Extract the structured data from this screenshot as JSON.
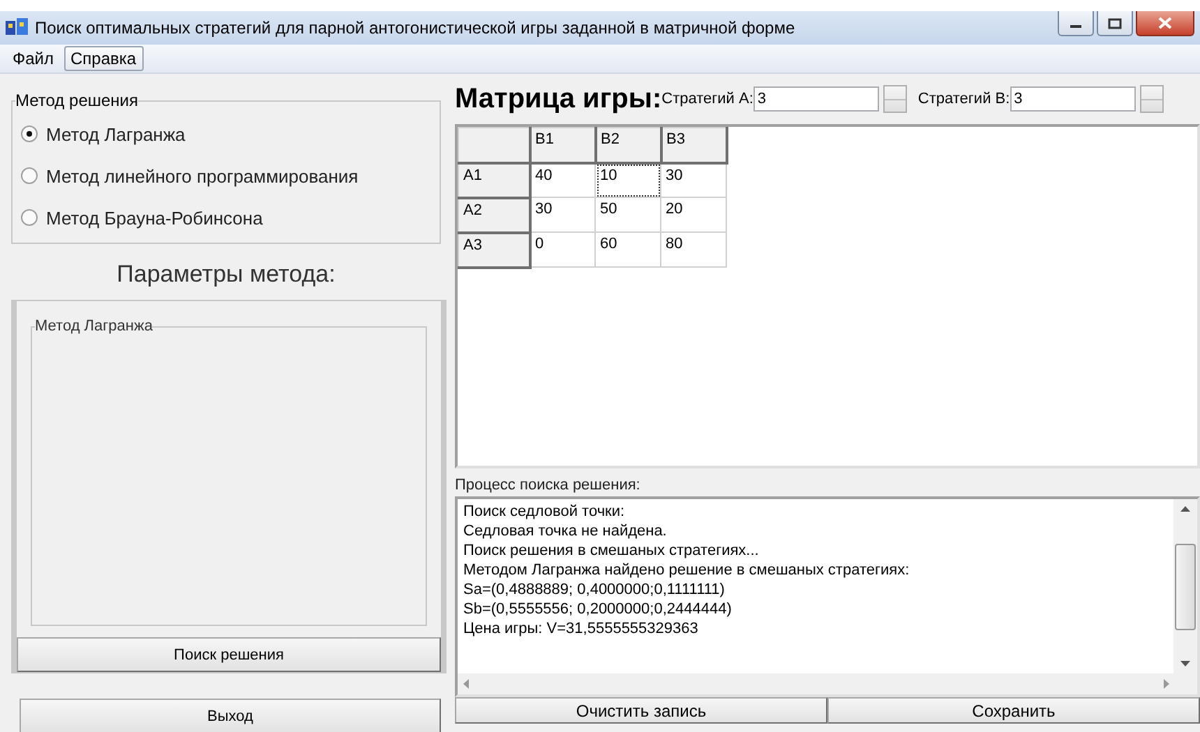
{
  "window": {
    "title": "Поиск оптимальных стратегий для парной антогонистической игры заданной в матричной форме"
  },
  "menu": [
    {
      "label": "Файл",
      "selected": false
    },
    {
      "label": "Справка",
      "selected": true
    }
  ],
  "method_group": {
    "title": "Метод решения",
    "options": [
      {
        "label": "Метод Лагранжа",
        "selected": true
      },
      {
        "label": "Метод линейного программирования",
        "selected": false
      },
      {
        "label": "Метод Брауна-Робинсона",
        "selected": false
      }
    ]
  },
  "params_title": "Параметры метода:",
  "params_group": {
    "title": "Метод Лагранжа"
  },
  "search_button": "Поиск решения",
  "exit_button": "Выход",
  "matrix": {
    "title": "Матрица игры:",
    "strategies": [
      {
        "label": "Стратегий А:",
        "value": "3"
      },
      {
        "label": "Стратегий В:",
        "value": "3"
      }
    ],
    "columns": [
      "B1",
      "B2",
      "B3"
    ],
    "rows": [
      {
        "header": "A1",
        "cells": [
          {
            "value": "40",
            "focused": false
          },
          {
            "value": "10",
            "focused": true
          },
          {
            "value": "30",
            "focused": false
          }
        ]
      },
      {
        "header": "A2",
        "cells": [
          {
            "value": "30",
            "focused": false
          },
          {
            "value": "50",
            "focused": false
          },
          {
            "value": "20",
            "focused": false
          }
        ]
      },
      {
        "header": "A3",
        "cells": [
          {
            "value": "0",
            "focused": false
          },
          {
            "value": "60",
            "focused": false
          },
          {
            "value": "80",
            "focused": false
          }
        ]
      }
    ]
  },
  "log": {
    "title": "Процесс поиска решения:",
    "lines": [
      "Поиск седловой точки:",
      "Седловая точка не найдена.",
      "Поиск решения в смешаных стратегиях...",
      "Методом Лагранжа найдено решение в смешаных стратегиях:",
      "Sa=(0,4888889; 0,4000000;0,1111111)",
      "Sb=(0,5555556; 0,2000000;0,2444444)",
      "Цена игры: V=31,5555555329363"
    ]
  },
  "log_buttons": [
    "Очистить запись",
    "Сохранить"
  ]
}
